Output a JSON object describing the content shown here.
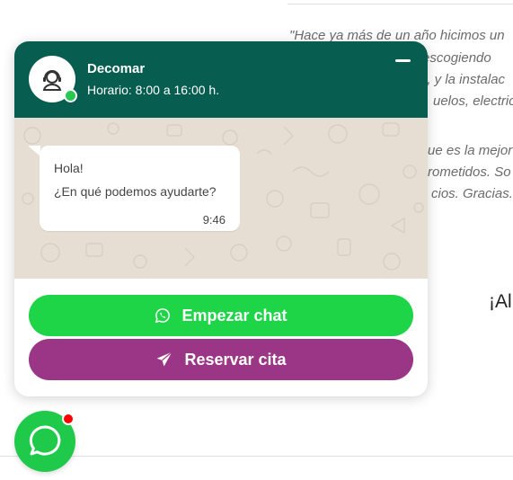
{
  "background_page": {
    "testimonial_lines": [
      "\"Hace ya más de un año hicimos un",
      "os escogiendo",
      "o, y la instalac",
      "uelos, electric",
      "ue es la mejor",
      "rometidos. So",
      "cios. Gracias."
    ],
    "heading_fragment": "¡Al"
  },
  "widget": {
    "header": {
      "name": "Decomar",
      "schedule": "Horario: 8:00 a 16:00 h.",
      "status": "online"
    },
    "message": {
      "line1": "Hola!",
      "line2": "¿En qué podemos ayudarte?",
      "time": "9:46"
    },
    "buttons": {
      "chat_label": "Empezar chat",
      "booking_label": "Reservar cita"
    }
  },
  "colors": {
    "header": "#085d51",
    "chat_button": "#1ed548",
    "booking_button": "#9b3585",
    "fab": "#1fc94a",
    "notification": "#ff0000"
  },
  "icons": {
    "avatar": "support-agent-icon",
    "chat_button": "whatsapp-icon",
    "booking_button": "paper-plane-icon",
    "fab": "chat-bubble-icon"
  }
}
